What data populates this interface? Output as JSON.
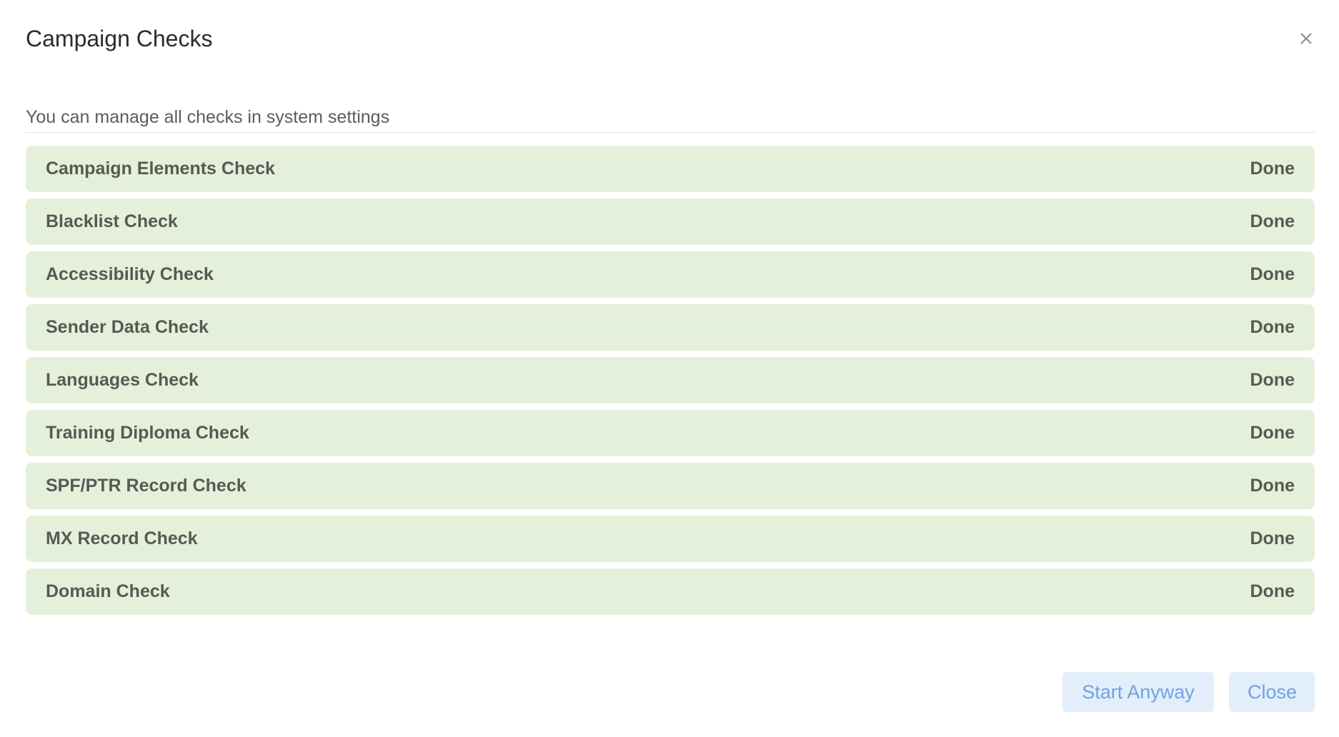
{
  "dialog": {
    "title": "Campaign Checks",
    "close_icon": "close-icon"
  },
  "hint": "You can manage all checks in system settings",
  "checks": [
    {
      "name": "Campaign Elements Check",
      "status": "Done"
    },
    {
      "name": "Blacklist Check",
      "status": "Done"
    },
    {
      "name": "Accessibility Check",
      "status": "Done"
    },
    {
      "name": "Sender Data Check",
      "status": "Done"
    },
    {
      "name": "Languages Check",
      "status": "Done"
    },
    {
      "name": "Training Diploma Check",
      "status": "Done"
    },
    {
      "name": "SPF/PTR Record Check",
      "status": "Done"
    },
    {
      "name": "MX Record Check",
      "status": "Done"
    },
    {
      "name": "Domain Check",
      "status": "Done"
    }
  ],
  "footer": {
    "start_anyway_label": "Start Anyway",
    "close_label": "Close"
  },
  "colors": {
    "row_background": "#e5f0da",
    "row_text": "#555a55",
    "button_background": "#e3eefb",
    "button_text": "#6ea3e0"
  }
}
